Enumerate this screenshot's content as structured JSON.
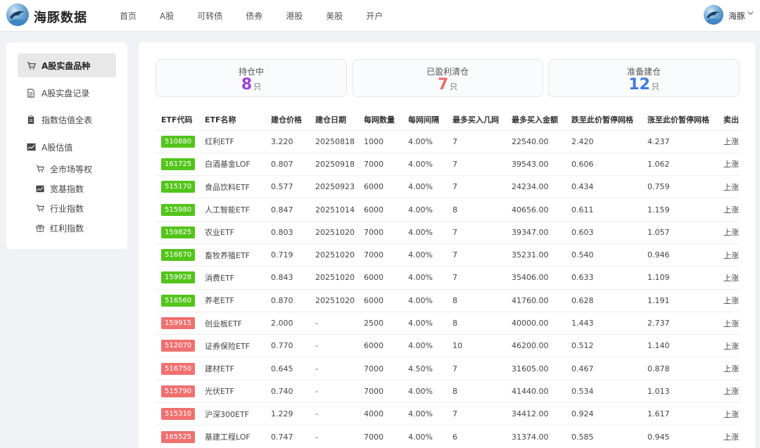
{
  "brand": {
    "name": "海豚数据"
  },
  "nav": [
    "首页",
    "A股",
    "可转债",
    "债券",
    "港股",
    "美股",
    "开户"
  ],
  "user": {
    "name": "海豚"
  },
  "sidebar": {
    "items": [
      "A股实盘品种",
      "A股实盘记录",
      "指数估值全表",
      "A股估值"
    ],
    "subitems": [
      "全市场等权",
      "宽基指数",
      "行业指数",
      "红利指数"
    ]
  },
  "stats": [
    {
      "label": "持仓中",
      "value": "8",
      "unit": "只",
      "color": "#9b3fd6"
    },
    {
      "label": "已盈利清仓",
      "value": "7",
      "unit": "只",
      "color": "#f06a6a"
    },
    {
      "label": "准备建仓",
      "value": "12",
      "unit": "只",
      "color": "#3d7be0"
    }
  ],
  "table": {
    "headers": [
      "ETF代码",
      "ETF名称",
      "建仓价格",
      "建仓日期",
      "每网数量",
      "每网间隔",
      "最多买入几网",
      "最多买入金额",
      "跌至此价暂停网格",
      "涨至此价暂停网格",
      "卖出"
    ],
    "rows": [
      {
        "code": "510880",
        "status": "green",
        "cells": [
          "红利ETF",
          "3.220",
          "20250818",
          "1000",
          "4.00%",
          "7",
          "22540.00",
          "2.420",
          "4.237",
          "上涨"
        ]
      },
      {
        "code": "161725",
        "status": "green",
        "cells": [
          "白酒基金LOF",
          "0.807",
          "20250918",
          "7000",
          "4.00%",
          "7",
          "39543.00",
          "0.606",
          "1.062",
          "上涨"
        ]
      },
      {
        "code": "515170",
        "status": "green",
        "cells": [
          "食品饮料ETF",
          "0.577",
          "20250923",
          "6000",
          "4.00%",
          "7",
          "24234.00",
          "0.434",
          "0.759",
          "上涨"
        ]
      },
      {
        "code": "515980",
        "status": "green",
        "cells": [
          "人工智能ETF",
          "0.847",
          "20251014",
          "6000",
          "4.00%",
          "8",
          "40656.00",
          "0.611",
          "1.159",
          "上涨"
        ]
      },
      {
        "code": "159825",
        "status": "green",
        "cells": [
          "农业ETF",
          "0.803",
          "20251020",
          "7000",
          "4.00%",
          "7",
          "39347.00",
          "0.603",
          "1.057",
          "上涨"
        ]
      },
      {
        "code": "516670",
        "status": "green",
        "cells": [
          "畜牧养殖ETF",
          "0.719",
          "20251020",
          "7000",
          "4.00%",
          "7",
          "35231.00",
          "0.540",
          "0.946",
          "上涨"
        ]
      },
      {
        "code": "159928",
        "status": "green",
        "cells": [
          "消费ETF",
          "0.843",
          "20251020",
          "6000",
          "4.00%",
          "7",
          "35406.00",
          "0.633",
          "1.109",
          "上涨"
        ]
      },
      {
        "code": "516560",
        "status": "green",
        "cells": [
          "养老ETF",
          "0.870",
          "20251020",
          "6000",
          "4.00%",
          "8",
          "41760.00",
          "0.628",
          "1.191",
          "上涨"
        ]
      },
      {
        "code": "159915",
        "status": "red",
        "cells": [
          "创业板ETF",
          "2.000",
          "-",
          "2500",
          "4.00%",
          "8",
          "40000.00",
          "1.443",
          "2.737",
          "上涨"
        ]
      },
      {
        "code": "512070",
        "status": "red",
        "cells": [
          "证券保险ETF",
          "0.770",
          "-",
          "6000",
          "4.00%",
          "10",
          "46200.00",
          "0.512",
          "1.140",
          "上涨"
        ]
      },
      {
        "code": "516750",
        "status": "red",
        "cells": [
          "建材ETF",
          "0.645",
          "-",
          "7000",
          "4.50%",
          "7",
          "31605.00",
          "0.467",
          "0.878",
          "上涨"
        ]
      },
      {
        "code": "515790",
        "status": "red",
        "cells": [
          "光伏ETF",
          "0.740",
          "-",
          "7000",
          "4.00%",
          "8",
          "41440.00",
          "0.534",
          "1.013",
          "上涨"
        ]
      },
      {
        "code": "515310",
        "status": "red",
        "cells": [
          "沪深300ETF",
          "1.229",
          "-",
          "4000",
          "4.00%",
          "7",
          "34412.00",
          "0.924",
          "1.617",
          "上涨"
        ]
      },
      {
        "code": "165525",
        "status": "red",
        "cells": [
          "基建工程LOF",
          "0.747",
          "-",
          "7000",
          "4.00%",
          "6",
          "31374.00",
          "0.585",
          "0.945",
          "上涨"
        ]
      }
    ]
  }
}
